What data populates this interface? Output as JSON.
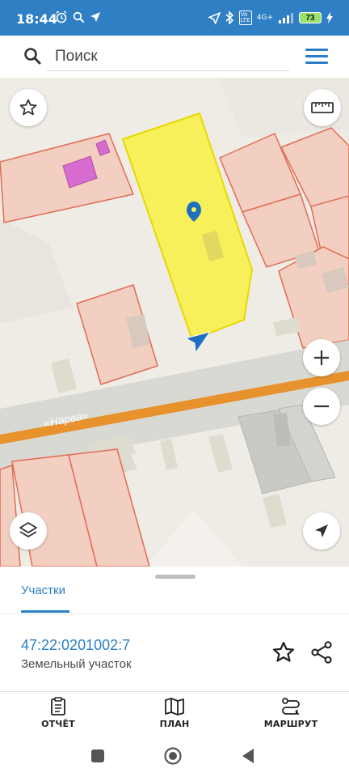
{
  "status_bar": {
    "time": "18:44",
    "network_label": "4G+",
    "volte_label": "Vo LTE",
    "battery": "73"
  },
  "search": {
    "placeholder": "Поиск"
  },
  "map": {
    "road_label": "«Нарва»",
    "colors": {
      "selected_parcel": "#f7f05a",
      "parcel_outline": "#e26b55",
      "parcel_fill": "#f2cfc0",
      "road": "#d9d9d3",
      "road_center": "#e8922d",
      "marker": "#1e6fc0"
    }
  },
  "sheet": {
    "tab_label": "Участки",
    "parcel_number": "47:22:0201002:7",
    "parcel_type": "Земельный участок"
  },
  "bottom_nav": {
    "items": [
      {
        "label": "ОТЧЁТ",
        "icon": "report-icon"
      },
      {
        "label": "ПЛАН",
        "icon": "map-icon"
      },
      {
        "label": "МАРШРУТ",
        "icon": "route-icon"
      }
    ]
  },
  "accent_color": "#2a7fc4"
}
